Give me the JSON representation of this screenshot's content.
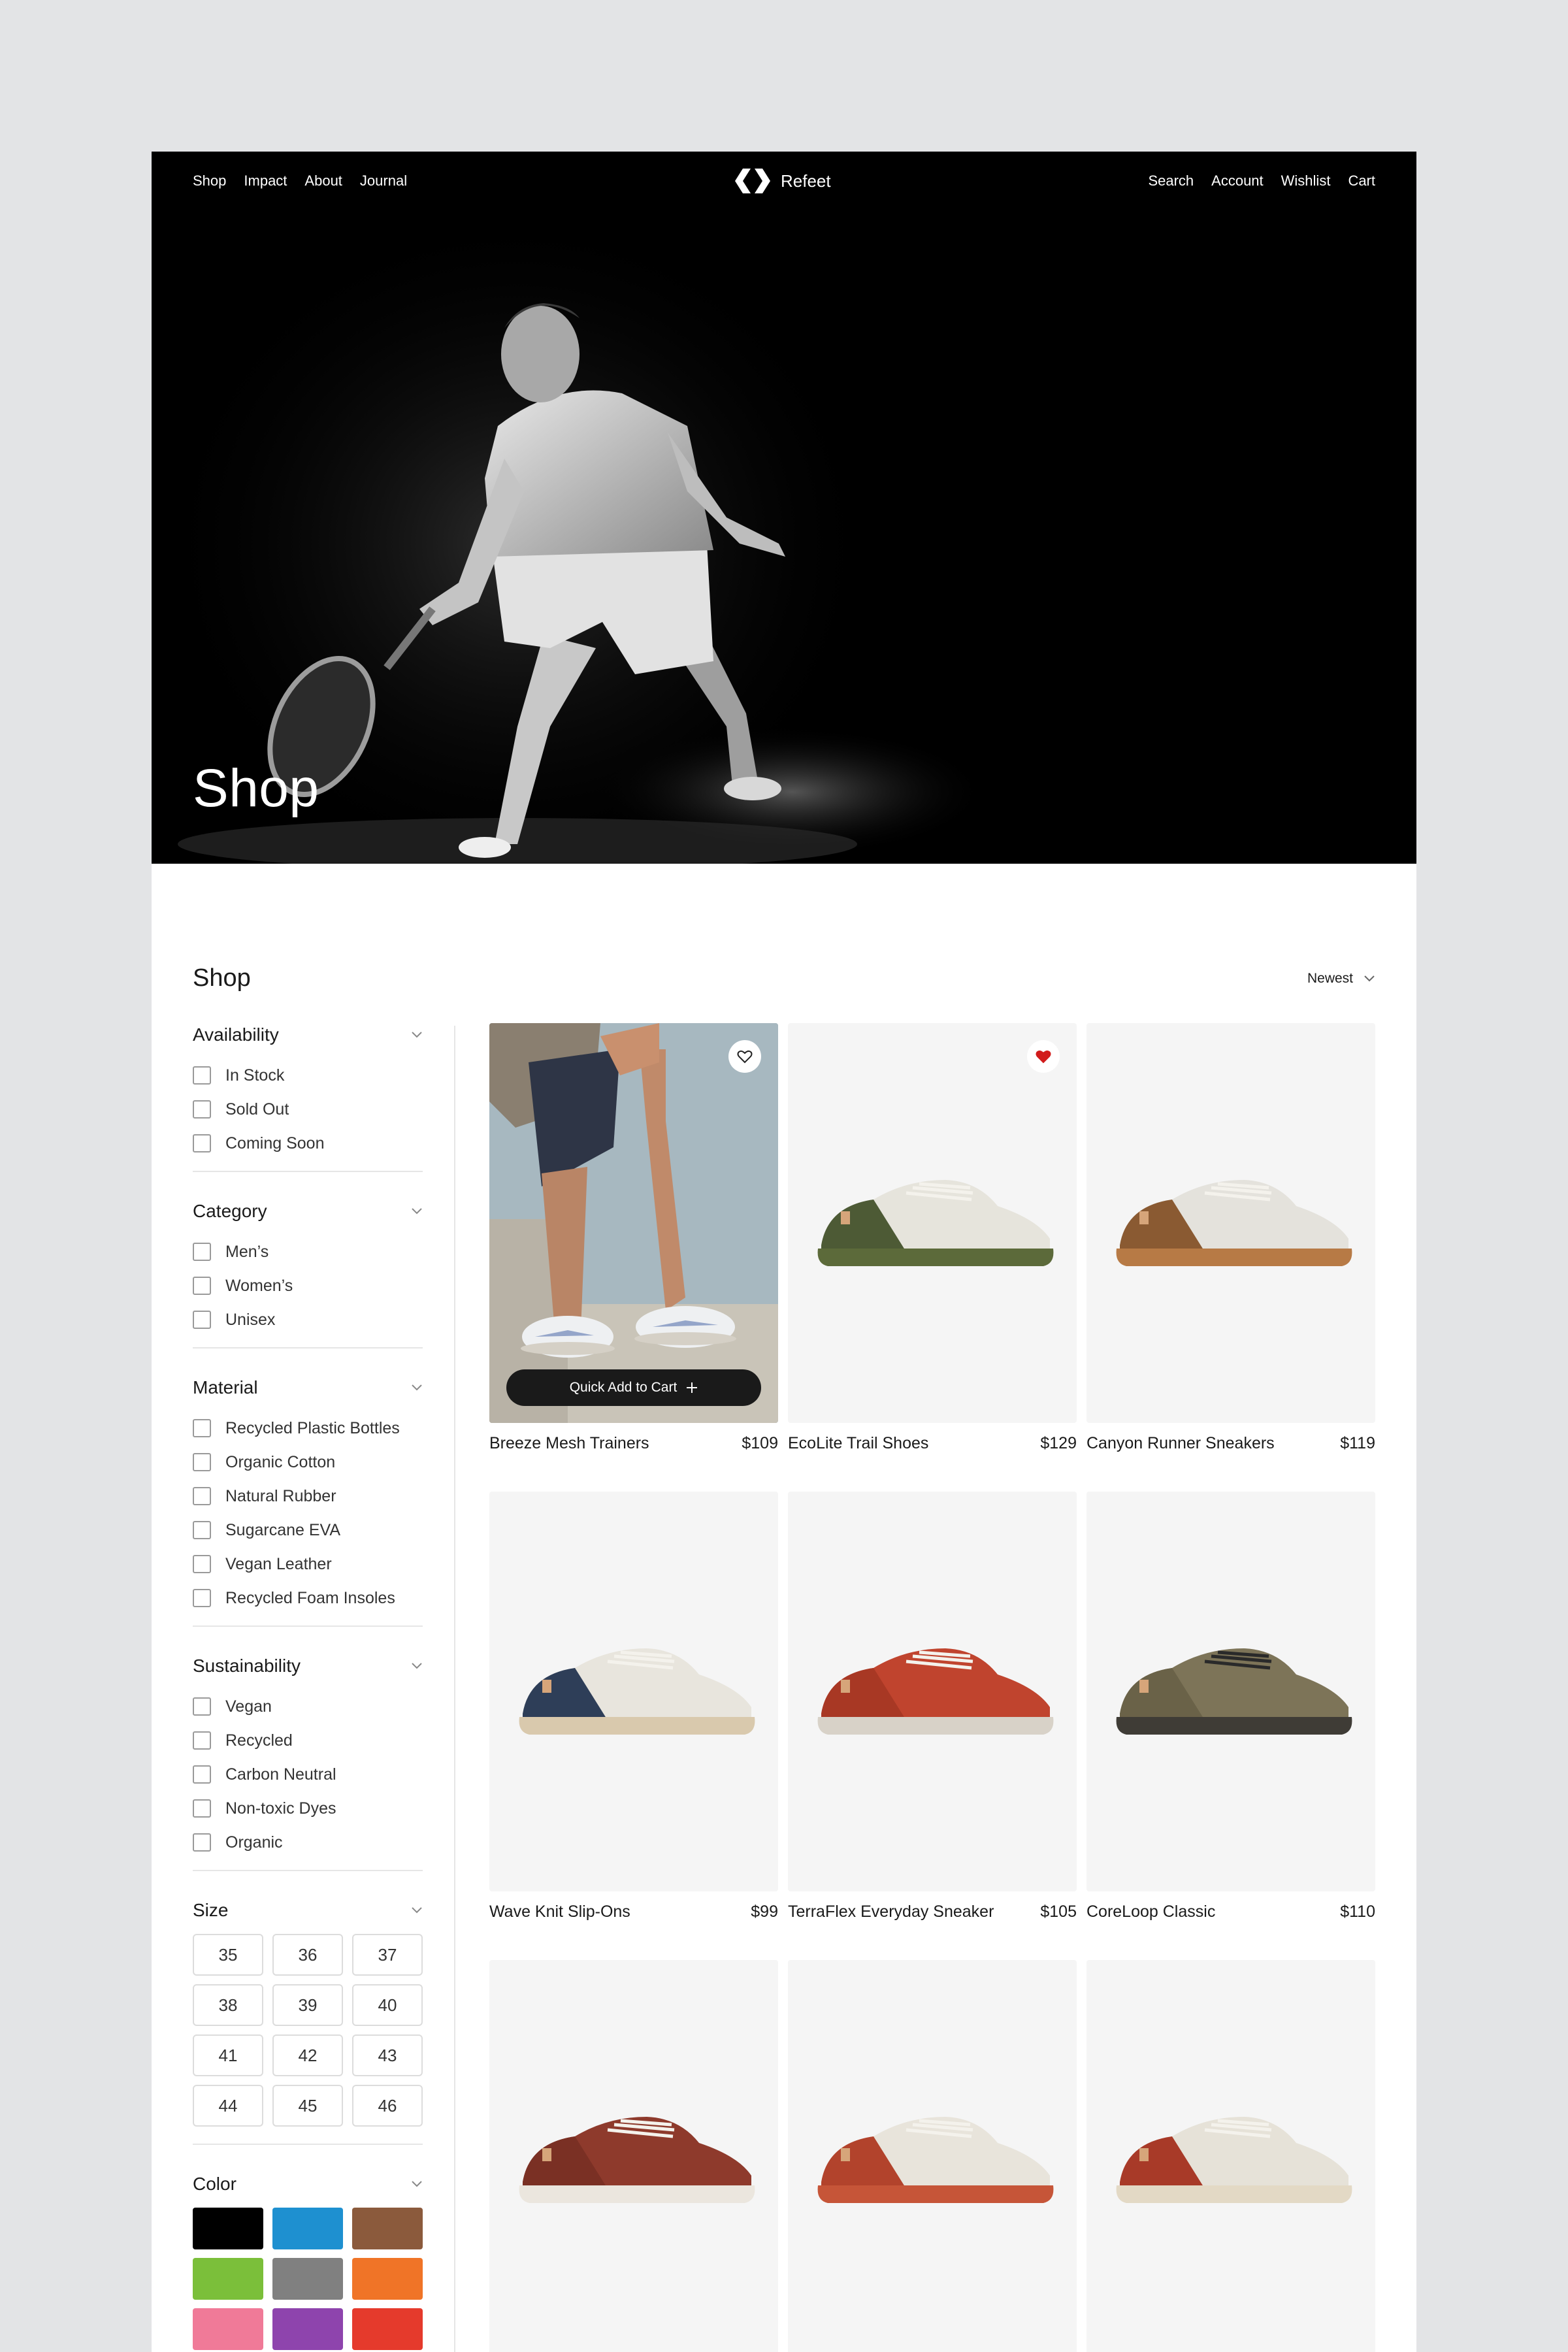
{
  "nav": {
    "left": [
      "Shop",
      "Impact",
      "About",
      "Journal"
    ],
    "brand": "Refeet",
    "right": [
      "Search",
      "Account",
      "Wishlist",
      "Cart"
    ]
  },
  "hero": {
    "title": "Shop"
  },
  "shop": {
    "title": "Shop",
    "sort_label": "Newest"
  },
  "filters": {
    "availability": {
      "title": "Availability",
      "options": [
        "In Stock",
        "Sold Out",
        "Coming Soon"
      ]
    },
    "category": {
      "title": "Category",
      "options": [
        "Men’s",
        "Women’s",
        "Unisex"
      ]
    },
    "material": {
      "title": "Material",
      "options": [
        "Recycled Plastic Bottles",
        "Organic Cotton",
        "Natural Rubber",
        "Sugarcane EVA",
        "Vegan Leather",
        "Recycled Foam Insoles"
      ]
    },
    "sustainability": {
      "title": "Sustainability",
      "options": [
        "Vegan",
        "Recycled",
        "Carbon Neutral",
        "Non-toxic Dyes",
        "Organic"
      ]
    },
    "size": {
      "title": "Size",
      "options": [
        "35",
        "36",
        "37",
        "38",
        "39",
        "40",
        "41",
        "42",
        "43",
        "44",
        "45",
        "46"
      ]
    },
    "color": {
      "title": "Color",
      "swatches": [
        "#000000",
        "#1e90d0",
        "#8b5a3c",
        "#7bbf3a",
        "#808080",
        "#f07427",
        "#f07a98",
        "#8e44ad",
        "#e53a2c"
      ]
    }
  },
  "products": [
    {
      "name": "Breeze Mesh Trainers",
      "price": "$109",
      "quick_add": "Quick Add to Cart",
      "wishlisted": false
    },
    {
      "name": "EcoLite Trail Shoes",
      "price": "$129",
      "wishlisted": true,
      "upper": "#e6e4dc",
      "accent": "#4d5a35",
      "sole": "#5c6a3a"
    },
    {
      "name": "Canyon Runner Sneakers",
      "price": "$119",
      "upper": "#e4e2dc",
      "accent": "#8a5a32",
      "sole": "#b77a45"
    },
    {
      "name": "Wave Knit Slip-Ons",
      "price": "$99",
      "upper": "#e8e5dd",
      "accent": "#2e3e58",
      "sole": "#d9c9ad"
    },
    {
      "name": "TerraFlex Everyday Sneaker",
      "price": "$105",
      "upper": "#c0442e",
      "accent": "#a83824",
      "sole": "#d8d2c8"
    },
    {
      "name": "CoreLoop Classic",
      "price": "$110",
      "upper": "#7d7458",
      "accent": "#6a6248",
      "sole": "#3f3c36"
    },
    {
      "name": "",
      "price": "",
      "upper": "#8e3a2c",
      "accent": "#7a3024",
      "sole": "#ebe6de"
    },
    {
      "name": "",
      "price": "",
      "upper": "#e8e4db",
      "accent": "#b2432c",
      "sole": "#c65538"
    },
    {
      "name": "",
      "price": "",
      "upper": "#e6e2d8",
      "accent": "#a83a28",
      "sole": "#e3d9c5"
    }
  ],
  "icons": {
    "heart_outline": "heart-icon",
    "heart_filled": "heart-filled-icon",
    "chevron": "chevron-down-icon",
    "plus": "plus-icon"
  }
}
